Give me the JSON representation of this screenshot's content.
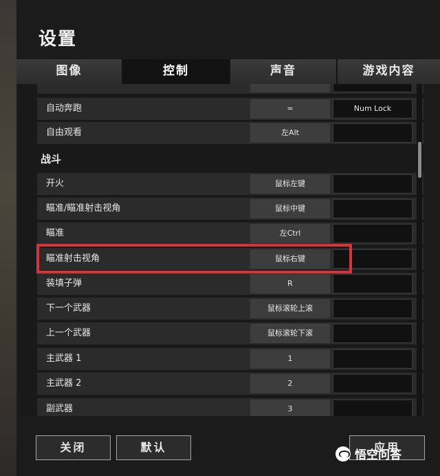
{
  "title": "设置",
  "tabs": [
    {
      "label": "图像",
      "active": false
    },
    {
      "label": "控制",
      "active": true
    },
    {
      "label": "声音",
      "active": false
    },
    {
      "label": "游戏内容",
      "active": false
    }
  ],
  "rows": [
    {
      "label": "",
      "key1": "",
      "key2": ""
    },
    {
      "label": "自动奔跑",
      "key1": "=",
      "key2": "Num Lock"
    },
    {
      "label": "自由观看",
      "key1": "左Alt",
      "key2": ""
    },
    {
      "label": "开火",
      "key1": "鼠标左键",
      "key2": ""
    },
    {
      "label": "瞄准/瞄准射击视角",
      "key1": "鼠标中键",
      "key2": ""
    },
    {
      "label": "瞄准",
      "key1": "左Ctrl",
      "key2": ""
    },
    {
      "label": "瞄准射击视角",
      "key1": "鼠标右键",
      "key2": ""
    },
    {
      "label": "装填子弹",
      "key1": "R",
      "key2": ""
    },
    {
      "label": "下一个武器",
      "key1": "鼠标滚轮上滚",
      "key2": ""
    },
    {
      "label": "上一个武器",
      "key1": "鼠标滚轮下滚",
      "key2": ""
    },
    {
      "label": "主武器 1",
      "key1": "1",
      "key2": ""
    },
    {
      "label": "主武器 2",
      "key1": "2",
      "key2": ""
    },
    {
      "label": "副武器",
      "key1": "3",
      "key2": ""
    }
  ],
  "section_combat": "战斗",
  "buttons": {
    "close": "关闭",
    "default": "默认",
    "apply": "应用"
  },
  "watermark": "悟空问答",
  "colors": {
    "highlight": "#d9333a",
    "panel": "#1b1b1b",
    "row": "#2b2b2b"
  }
}
